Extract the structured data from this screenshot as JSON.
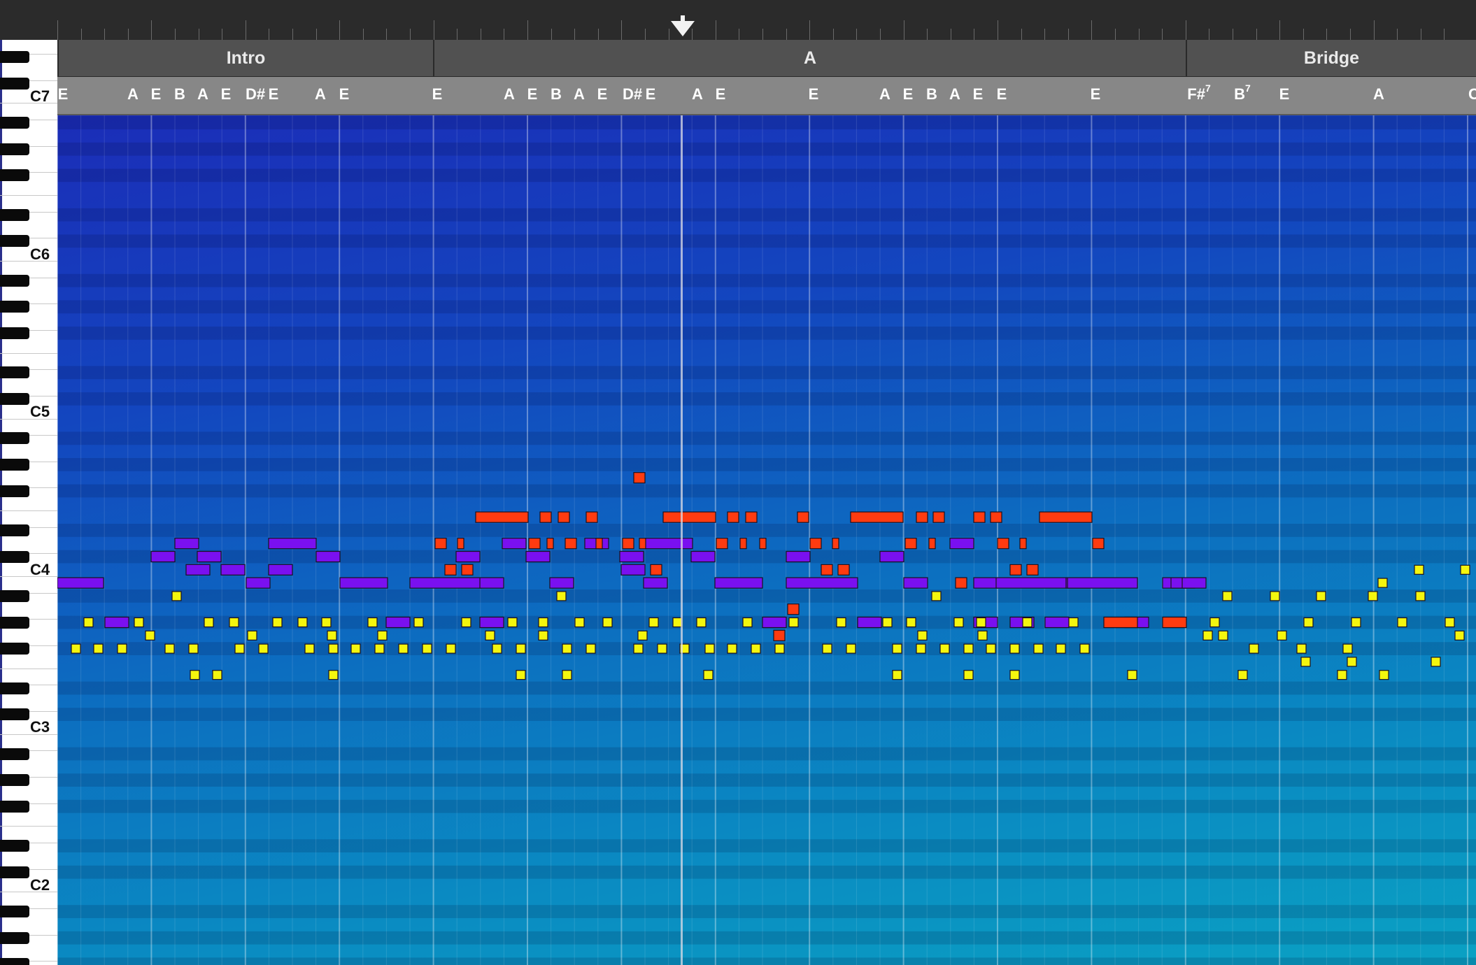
{
  "sections": [
    {
      "label": "Intro"
    },
    {
      "label": "A"
    },
    {
      "label": "Bridge"
    }
  ],
  "chords": [
    {
      "label": "E"
    },
    {
      "label": "A"
    },
    {
      "label": "E"
    },
    {
      "label": "B"
    },
    {
      "label": "A"
    },
    {
      "label": "E"
    },
    {
      "label": "D#"
    },
    {
      "label": "E"
    },
    {
      "label": "A"
    },
    {
      "label": "E"
    },
    {
      "label": "E"
    },
    {
      "label": "A"
    },
    {
      "label": "E"
    },
    {
      "label": "B"
    },
    {
      "label": "A"
    },
    {
      "label": "E"
    },
    {
      "label": "D#"
    },
    {
      "label": "E"
    },
    {
      "label": "A"
    },
    {
      "label": "E"
    },
    {
      "label": "E"
    },
    {
      "label": "A"
    },
    {
      "label": "E"
    },
    {
      "label": "B"
    },
    {
      "label": "A"
    },
    {
      "label": "E"
    },
    {
      "label": "E"
    },
    {
      "label": "E"
    },
    {
      "label": "F#",
      "sup": "7"
    },
    {
      "label": "B",
      "sup": "7"
    },
    {
      "label": "E"
    },
    {
      "label": "A"
    },
    {
      "label": "C"
    }
  ],
  "octave_labels": [
    "C7",
    "C6",
    "C5",
    "C4",
    "C3",
    "C2"
  ],
  "colors": {
    "melody": "#ff3b10",
    "harmony": "#7a10f0",
    "bass": "#f4f60e"
  },
  "icons": {
    "playhead": "playhead-triangle-icon"
  }
}
